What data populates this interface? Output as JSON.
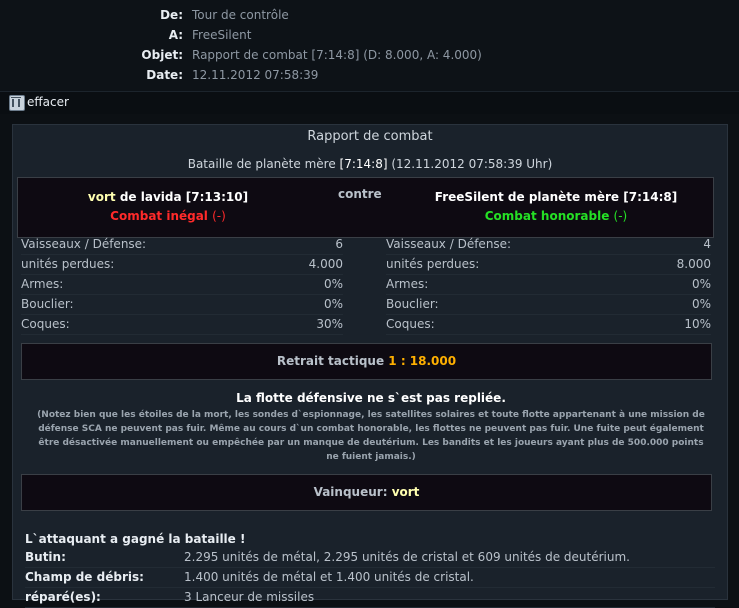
{
  "header": {
    "from_label": "De:",
    "from_value": "Tour de contrôle",
    "to_label": "A:",
    "to_value": "FreeSilent",
    "subject_label": "Objet:",
    "subject_value": "Rapport de combat [7:14:8] (D: 8.000, A: 4.000)",
    "date_label": "Date:",
    "date_value": "12.11.2012 07:58:39"
  },
  "toolbar": {
    "delete_label": "effacer"
  },
  "report": {
    "title": "Rapport de combat",
    "battle_prefix": "Bataille de planète mère",
    "battle_coords": "[7:14:8]",
    "battle_date": "(12.11.2012 07:58:39 Uhr)",
    "versus": "contre",
    "attacker": {
      "name": "vort",
      "origin": "de lavida",
      "coords": "[7:13:10]",
      "status": "Combat inégal",
      "status_suffix": "(-)"
    },
    "defender": {
      "name": "FreeSilent",
      "origin": "de planète mère",
      "coords": "[7:14:8]",
      "status": "Combat honorable",
      "status_suffix": "(-)"
    },
    "stats_attacker": [
      {
        "label": "Vaisseaux / Défense:",
        "value": "6"
      },
      {
        "label": "unités perdues:",
        "value": "4.000"
      },
      {
        "label": "Armes:",
        "value": "0%"
      },
      {
        "label": "Bouclier:",
        "value": "0%"
      },
      {
        "label": "Coques:",
        "value": "30%"
      }
    ],
    "stats_defender": [
      {
        "label": "Vaisseaux / Défense:",
        "value": "4"
      },
      {
        "label": "unités perdues:",
        "value": "8.000"
      },
      {
        "label": "Armes:",
        "value": "0%"
      },
      {
        "label": "Bouclier:",
        "value": "0%"
      },
      {
        "label": "Coques:",
        "value": "10%"
      }
    ],
    "retreat_label": "Retrait tactique",
    "retreat_value": "1 : 18.000",
    "notice_title": "La flotte défensive ne s`est pas repliée.",
    "notice_text": "(Notez bien que les étoiles de la mort, les sondes d`espionnage, les satellites solaires et toute flotte appartenant à une mission de défense SCA ne peuvent pas fuir. Même au cours d`un combat honorable, les flottes ne peuvent pas fuir. Une fuite peut également être désactivée manuellement ou empêchée par un manque de deutérium. Les bandits et les joueurs ayant plus de 500.000 points ne fuient jamais.)",
    "winner_label": "Vainqueur:",
    "winner_value": "vort",
    "result_heading": "L`attaquant a gagné la bataille !",
    "loot_label": "Butin:",
    "loot_value": "2.295 unités de métal, 2.295 unités de cristal et 609 unités de deutérium.",
    "debris_label": "Champ de débris:",
    "debris_value": "1.400 unités de métal et 1.400 unités de cristal.",
    "repaired_label": "réparé(es):",
    "repaired_value": "3 Lanceur de missiles"
  },
  "colors": {
    "background": "#0c1014",
    "panel": "#1a222b",
    "attacker_name": "#ffffb0",
    "unfair": "#ff2a2a",
    "honorable": "#25e025",
    "highlight": "#ffb000"
  }
}
